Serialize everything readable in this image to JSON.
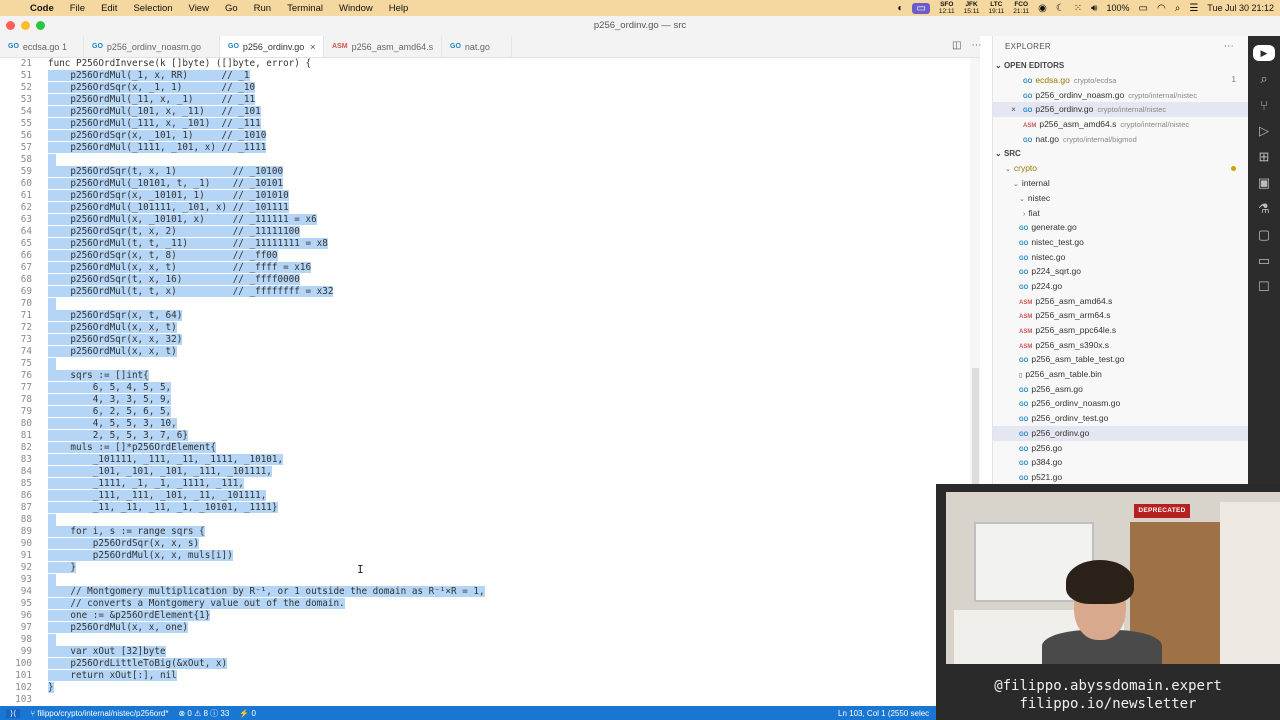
{
  "menubar": {
    "app": "Code",
    "items": [
      "File",
      "Edit",
      "Selection",
      "View",
      "Go",
      "Run",
      "Terminal",
      "Window",
      "Help"
    ],
    "clocks": [
      {
        "city": "SFO",
        "time": "12:11"
      },
      {
        "city": "JFK",
        "time": "15:11"
      },
      {
        "city": "LTC",
        "time": "19:11"
      },
      {
        "city": "FCO",
        "time": "21:11"
      }
    ],
    "battery": "100%",
    "datetime": "Tue Jul 30  21:12"
  },
  "window": {
    "title": "p256_ordinv.go — src"
  },
  "tabs": [
    {
      "label": "ecdsa.go",
      "badge": "1",
      "icon": "go",
      "active": false
    },
    {
      "label": "p256_ordinv_noasm.go",
      "badge": "",
      "icon": "go",
      "active": false
    },
    {
      "label": "p256_ordinv.go",
      "badge": "",
      "icon": "go",
      "active": true
    },
    {
      "label": "p256_asm_amd64.s",
      "badge": "",
      "icon": "asm",
      "active": false
    },
    {
      "label": "nat.go",
      "badge": "",
      "icon": "go",
      "active": false
    }
  ],
  "editor": {
    "lines": [
      {
        "n": "21",
        "text": "func P256OrdInverse(k []byte) ([]byte, error) {",
        "sel": false
      },
      {
        "n": "51",
        "text": "    p256OrdMul(_1, x, RR)      // _1",
        "sel": true
      },
      {
        "n": "52",
        "text": "    p256OrdSqr(x, _1, 1)       // _10",
        "sel": true
      },
      {
        "n": "53",
        "text": "    p256OrdMul(_11, x, _1)     // _11",
        "sel": true
      },
      {
        "n": "54",
        "text": "    p256OrdMul(_101, x, _11)   // _101",
        "sel": true
      },
      {
        "n": "55",
        "text": "    p256OrdMul(_111, x, _101)  // _111",
        "sel": true
      },
      {
        "n": "56",
        "text": "    p256OrdSqr(x, _101, 1)     // _1010",
        "sel": true
      },
      {
        "n": "57",
        "text": "    p256OrdMul(_1111, _101, x) // _1111",
        "sel": true
      },
      {
        "n": "58",
        "text": "",
        "sel": true
      },
      {
        "n": "59",
        "text": "    p256OrdSqr(t, x, 1)          // _10100",
        "sel": true
      },
      {
        "n": "60",
        "text": "    p256OrdMul(_10101, t, _1)    // _10101",
        "sel": true
      },
      {
        "n": "61",
        "text": "    p256OrdSqr(x, _10101, 1)     // _101010",
        "sel": true
      },
      {
        "n": "62",
        "text": "    p256OrdMul(_101111, _101, x) // _101111",
        "sel": true
      },
      {
        "n": "63",
        "text": "    p256OrdMul(x, _10101, x)     // _111111 = x6",
        "sel": true
      },
      {
        "n": "64",
        "text": "    p256OrdSqr(t, x, 2)          // _11111100",
        "sel": true
      },
      {
        "n": "65",
        "text": "    p256OrdMul(t, t, _11)        // _11111111 = x8",
        "sel": true
      },
      {
        "n": "66",
        "text": "    p256OrdSqr(x, t, 8)          // _ff00",
        "sel": true
      },
      {
        "n": "67",
        "text": "    p256OrdMul(x, x, t)          // _ffff = x16",
        "sel": true
      },
      {
        "n": "68",
        "text": "    p256OrdSqr(t, x, 16)         // _ffff0000",
        "sel": true
      },
      {
        "n": "69",
        "text": "    p256OrdMul(t, t, x)          // _ffffffff = x32",
        "sel": true
      },
      {
        "n": "70",
        "text": "",
        "sel": true
      },
      {
        "n": "71",
        "text": "    p256OrdSqr(x, t, 64)",
        "sel": true
      },
      {
        "n": "72",
        "text": "    p256OrdMul(x, x, t)",
        "sel": true
      },
      {
        "n": "73",
        "text": "    p256OrdSqr(x, x, 32)",
        "sel": true
      },
      {
        "n": "74",
        "text": "    p256OrdMul(x, x, t)",
        "sel": true
      },
      {
        "n": "75",
        "text": "",
        "sel": true
      },
      {
        "n": "76",
        "text": "    sqrs := []int{",
        "sel": true
      },
      {
        "n": "77",
        "text": "        6, 5, 4, 5, 5,",
        "sel": true
      },
      {
        "n": "78",
        "text": "        4, 3, 3, 5, 9,",
        "sel": true
      },
      {
        "n": "79",
        "text": "        6, 2, 5, 6, 5,",
        "sel": true
      },
      {
        "n": "80",
        "text": "        4, 5, 5, 3, 10,",
        "sel": true
      },
      {
        "n": "81",
        "text": "        2, 5, 5, 3, 7, 6}",
        "sel": true
      },
      {
        "n": "82",
        "text": "    muls := []*p256OrdElement{",
        "sel": true
      },
      {
        "n": "83",
        "text": "        _101111, _111, _11, _1111, _10101,",
        "sel": true
      },
      {
        "n": "84",
        "text": "        _101, _101, _101, _111, _101111,",
        "sel": true
      },
      {
        "n": "85",
        "text": "        _1111, _1, _1, _1111, _111,",
        "sel": true
      },
      {
        "n": "86",
        "text": "        _111, _111, _101, _11, _101111,",
        "sel": true
      },
      {
        "n": "87",
        "text": "        _11, _11, _11, _1, _10101, _1111}",
        "sel": true
      },
      {
        "n": "88",
        "text": "",
        "sel": true
      },
      {
        "n": "89",
        "text": "    for i, s := range sqrs {",
        "sel": true
      },
      {
        "n": "90",
        "text": "        p256OrdSqr(x, x, s)",
        "sel": true
      },
      {
        "n": "91",
        "text": "        p256OrdMul(x, x, muls[i])",
        "sel": true
      },
      {
        "n": "92",
        "text": "    }",
        "sel": true
      },
      {
        "n": "93",
        "text": "",
        "sel": true
      },
      {
        "n": "94",
        "text": "    // Montgomery multiplication by R⁻¹, or 1 outside the domain as R⁻¹×R = 1,",
        "sel": true
      },
      {
        "n": "95",
        "text": "    // converts a Montgomery value out of the domain.",
        "sel": true
      },
      {
        "n": "96",
        "text": "    one := &p256OrdElement{1}",
        "sel": true
      },
      {
        "n": "97",
        "text": "    p256OrdMul(x, x, one)",
        "sel": true
      },
      {
        "n": "98",
        "text": "",
        "sel": true
      },
      {
        "n": "99",
        "text": "    var xOut [32]byte",
        "sel": true
      },
      {
        "n": "100",
        "text": "    p256OrdLittleToBig(&xOut, x)",
        "sel": true
      },
      {
        "n": "101",
        "text": "    return xOut[:], nil",
        "sel": true
      },
      {
        "n": "102",
        "text": "}",
        "sel": true
      },
      {
        "n": "103",
        "text": "",
        "sel": false
      }
    ]
  },
  "explorer": {
    "title": "EXPLORER",
    "open_editors_label": "OPEN EDITORS",
    "open_editors": [
      {
        "name": "ecdsa.go",
        "path": "crypto/ecdsa",
        "badge": "1",
        "icon": "go"
      },
      {
        "name": "p256_ordinv_noasm.go",
        "path": "crypto/internal/nistec",
        "badge": "",
        "icon": "go"
      },
      {
        "name": "p256_ordinv.go",
        "path": "crypto/internal/nistec",
        "badge": "",
        "icon": "go"
      },
      {
        "name": "p256_asm_amd64.s",
        "path": "crypto/internal/nistec",
        "badge": "",
        "icon": "asm"
      },
      {
        "name": "nat.go",
        "path": "crypto/internal/bigmod",
        "badge": "",
        "icon": "go"
      }
    ],
    "src_label": "SRC",
    "folders": [
      "crypto",
      "internal",
      "nistec",
      "fiat"
    ],
    "files": [
      {
        "name": "generate.go",
        "icon": "go"
      },
      {
        "name": "nistec_test.go",
        "icon": "go"
      },
      {
        "name": "nistec.go",
        "icon": "go"
      },
      {
        "name": "p224_sqrt.go",
        "icon": "go"
      },
      {
        "name": "p224.go",
        "icon": "go"
      },
      {
        "name": "p256_asm_amd64.s",
        "icon": "asm"
      },
      {
        "name": "p256_asm_arm64.s",
        "icon": "asm"
      },
      {
        "name": "p256_asm_ppc64le.s",
        "icon": "asm"
      },
      {
        "name": "p256_asm_s390x.s",
        "icon": "asm"
      },
      {
        "name": "p256_asm_table_test.go",
        "icon": "go"
      },
      {
        "name": "p256_asm_table.bin",
        "icon": "bin"
      },
      {
        "name": "p256_asm.go",
        "icon": "go"
      },
      {
        "name": "p256_ordinv_noasm.go",
        "icon": "go"
      },
      {
        "name": "p256_ordinv_test.go",
        "icon": "go"
      },
      {
        "name": "p256_ordinv.go",
        "icon": "go"
      },
      {
        "name": "p256.go",
        "icon": "go"
      },
      {
        "name": "p384.go",
        "icon": "go"
      },
      {
        "name": "p521.go",
        "icon": "go"
      }
    ]
  },
  "statusbar": {
    "branch": "filippo/crypto/internal/nistec/p256ord*",
    "errors": "0",
    "warnings": "8",
    "infos": "33",
    "ports": "0",
    "position": "Ln 103, Col 1 (2550 selec"
  },
  "webcam": {
    "sign": "DEPRECATED",
    "handle": "@filippo.abyssdomain.expert",
    "newsletter": "filippo.io/newsletter"
  },
  "colors": {
    "selection": "#b4d5f5",
    "statusbar": "#1976d2",
    "menubar": "#f5d8a0",
    "go_icon": "#1f85c8",
    "asm_icon": "#d05757"
  }
}
